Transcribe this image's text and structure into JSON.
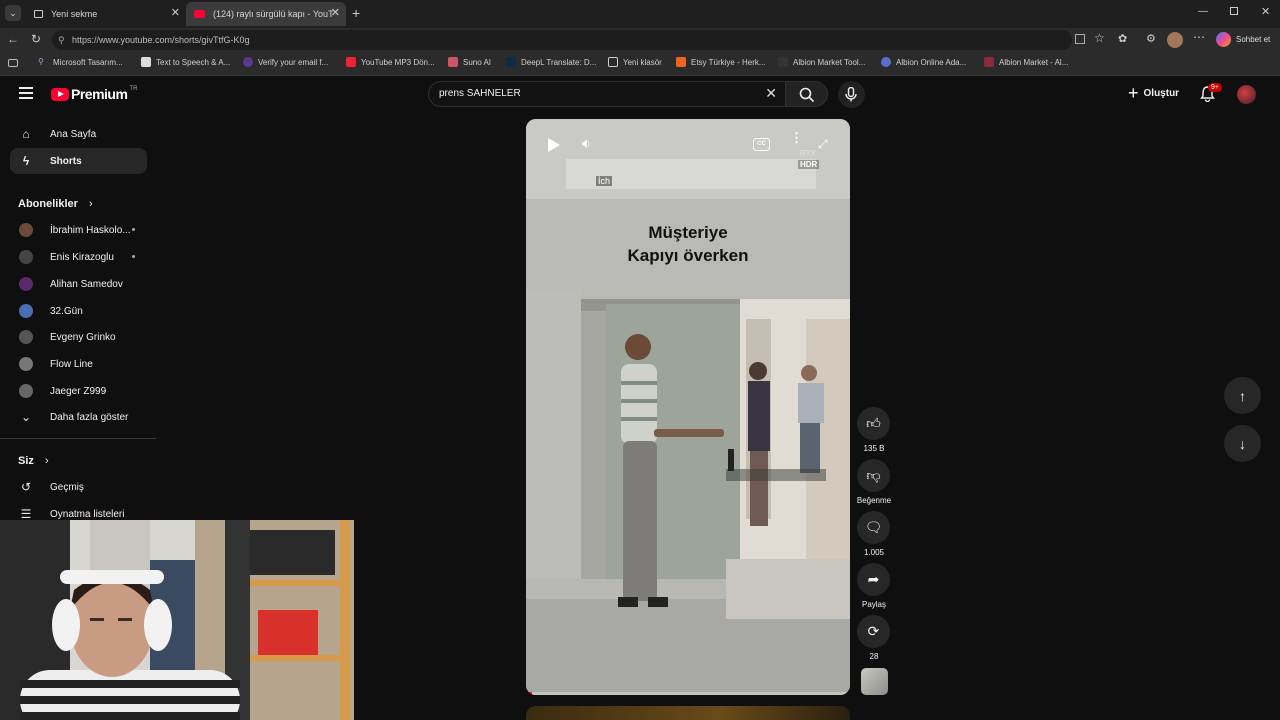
{
  "browser": {
    "tabs": [
      {
        "title": "Yeni sekme"
      },
      {
        "title": "(124) raylı sürgülü kapı - YouTube"
      }
    ],
    "url": "https://www.youtube.com/shorts/givTtfG-K0g",
    "profile_label": "Sohbet et",
    "bookmarks": [
      "Microsoft Tasarım...",
      "Text to Speech & A...",
      "Verify your email f...",
      "YouTube MP3 Dön...",
      "Suno AI",
      "DeepL Translate: D...",
      "Yeni klasör",
      "Etsy Türkiye - Herk...",
      "Albion Market Tool...",
      "Albion Online Ada...",
      "Albion Market - Al..."
    ]
  },
  "youtube": {
    "logo": "Premium",
    "logo_sup": "TR",
    "search_value": "prens SAHNELER",
    "create_label": "Oluştur",
    "notif_badge": "9+",
    "sidebar": {
      "main": [
        {
          "label": "Ana Sayfa",
          "icon": "home-icon"
        },
        {
          "label": "Shorts",
          "icon": "shorts-icon"
        }
      ],
      "subs_title": "Abonelikler",
      "subs": [
        {
          "label": "İbrahim Haskolo...",
          "color": "#6b4a3a",
          "dot": true
        },
        {
          "label": "Enis Kirazoglu",
          "color": "#444",
          "dot": true
        },
        {
          "label": "Alihan Samedov",
          "color": "#5a2a6a",
          "dot": false
        },
        {
          "label": "32.Gün",
          "color": "#4a6fb5",
          "dot": false
        },
        {
          "label": "Evgeny Grinko",
          "color": "#555",
          "dot": false
        },
        {
          "label": "Flow Line",
          "color": "#777",
          "dot": false
        },
        {
          "label": "Jaeger Z999",
          "color": "#666",
          "dot": false
        }
      ],
      "more_label": "Daha fazla göster",
      "you_title": "Siz",
      "you_items": [
        {
          "label": "Geçmiş",
          "icon": "history-icon"
        },
        {
          "label": "Oynatma listeleri",
          "icon": "playlists-icon"
        }
      ]
    },
    "video": {
      "overlay_line1": "Müşteriye",
      "overlay_line2": "Kapıyı överken",
      "tiny_label": "İch",
      "rtx_label": "RTX",
      "hdr_label": "HDR"
    },
    "actions": {
      "likes": "135 B",
      "dislike_label": "Beğenme",
      "comments": "1.005",
      "share_label": "Paylaş",
      "remix": "28"
    }
  }
}
